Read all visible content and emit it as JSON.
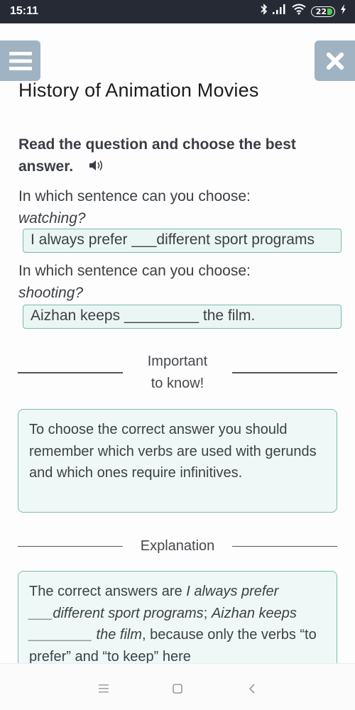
{
  "status_bar": {
    "time": "15:11",
    "battery_level": "22",
    "icons": [
      "bluetooth-icon",
      "signal-icon",
      "wifi-icon",
      "battery-icon",
      "charging-icon"
    ]
  },
  "header": {
    "menu_icon": "hamburger-menu-icon",
    "close_icon": "close-icon",
    "title": "History of Animation Movies"
  },
  "instruction": {
    "text": "Read the question and choose the best answer.",
    "audio_icon": "speaker-icon"
  },
  "questions": [
    {
      "prompt": "In which sentence can you choose:",
      "word": "watching?",
      "answer": "I always prefer ___different sport programs"
    },
    {
      "prompt": "In which sentence can you choose:",
      "word": "shooting?",
      "answer": "Aizhan keeps _________ the film."
    }
  ],
  "important": {
    "heading_line1": "Important",
    "heading_line2": "to know!",
    "text": "To choose the correct answer you should remember which verbs are used with gerunds and which ones require infinitives."
  },
  "explanation": {
    "heading": "Explanation",
    "text_intro": "The correct answers are ",
    "answer1_italic": "I always prefer ___different sport programs",
    "separator": "; ",
    "answer2_italic": "Aizhan keeps ________ the film",
    "text_rest": ", because only the verbs “to prefer” and “to keep” here"
  },
  "nav_bar": {
    "icons": [
      "recent-apps-icon",
      "home-icon",
      "back-icon"
    ]
  },
  "colors": {
    "status_bar_bg": "#262a35",
    "header_button_bg": "#9fb3c2",
    "answer_box_bg": "#eaf6f3",
    "answer_box_border": "#78b9ad",
    "info_box_bg": "#eef8f6",
    "battery_green": "#4bd04b"
  }
}
